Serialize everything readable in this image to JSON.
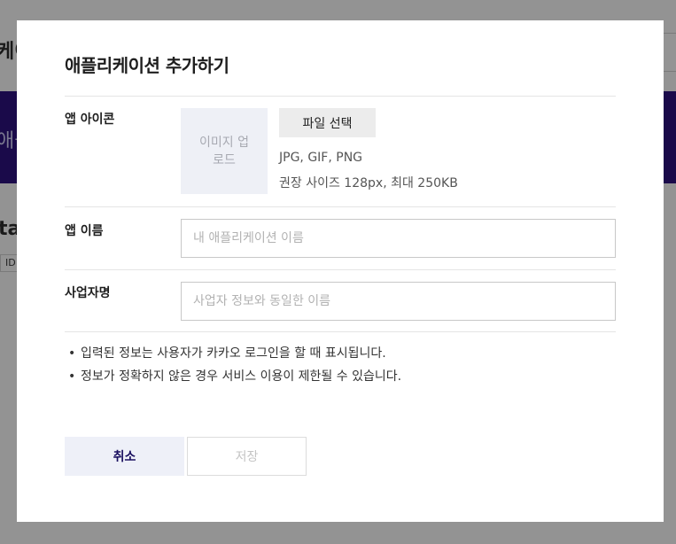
{
  "background": {
    "title_fragment": "케이",
    "band_text_fragment": "애플",
    "heading_fragment": "tal",
    "id_fragment": "ID"
  },
  "modal": {
    "title": "애플리케이션 추가하기",
    "app_icon": {
      "label": "앱 아이콘",
      "upload_text": "이미지 업로드",
      "file_button": "파일 선택",
      "formats": "JPG, GIF, PNG",
      "size_hint": "권장 사이즈 128px, 최대 250KB"
    },
    "app_name": {
      "label": "앱 이름",
      "placeholder": "내 애플리케이션 이름",
      "value": ""
    },
    "business_name": {
      "label": "사업자명",
      "placeholder": "사업자 정보와 동일한 이름",
      "value": ""
    },
    "notes": [
      "입력된 정보는 사용자가 카카오 로그인을 할 때 표시됩니다.",
      "정보가 정확하지 않은 경우 서비스 이용이 제한될 수 있습니다."
    ],
    "buttons": {
      "cancel": "취소",
      "save": "저장"
    }
  },
  "colors": {
    "overlay": "#939393",
    "brand_dark": "#1a0a4a",
    "cancel_bg": "#eef0f8",
    "cancel_text": "#1a1060"
  }
}
